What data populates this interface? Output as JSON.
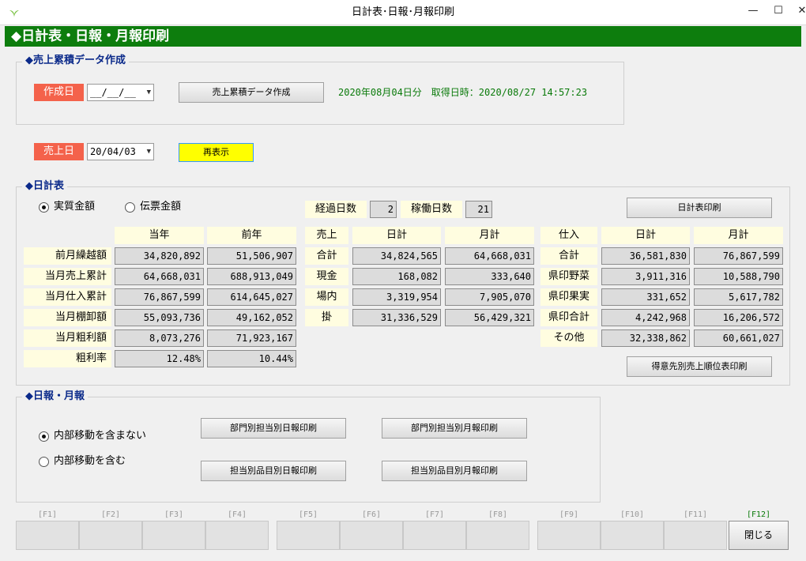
{
  "window": {
    "title": "日計表･日報･月報印刷",
    "min": "—",
    "max": "☐",
    "close": "✕"
  },
  "banner": "◆日計表・日報・月報印刷",
  "sales_data_group": {
    "title": "◆売上累積データ作成",
    "date_label": "作成日",
    "date_value": "__/__/__",
    "create_button": "売上累積データ作成",
    "status_text": "2020年08月04日分　取得日時：2020/08/27 14:57:23"
  },
  "sales_date": {
    "label": "売上日",
    "value": "20/04/03",
    "redisplay_button": "再表示"
  },
  "daily": {
    "title": "◆日計表",
    "radio_actual": "実質金額",
    "radio_slip": "伝票金額",
    "elapsed_label": "経過日数",
    "elapsed_value": "2",
    "working_label": "稼働日数",
    "working_value": "21",
    "print_button": "日計表印刷",
    "rank_button": "得意先別売上順位表印刷",
    "left_headers": [
      "当年",
      "前年"
    ],
    "left_rows": [
      {
        "label": "前月繰越額",
        "cur": "34,820,892",
        "prev": "51,506,907"
      },
      {
        "label": "当月売上累計",
        "cur": "64,668,031",
        "prev": "688,913,049"
      },
      {
        "label": "当月仕入累計",
        "cur": "76,867,599",
        "prev": "614,645,027"
      },
      {
        "label": "当月棚卸額",
        "cur": "55,093,736",
        "prev": "49,162,052"
      },
      {
        "label": "当月粗利額",
        "cur": "8,073,276",
        "prev": "71,923,167"
      },
      {
        "label": "粗利率",
        "cur": "12.48%",
        "prev": "10.44%"
      }
    ],
    "mid_headers": [
      "売上",
      "日計",
      "月計"
    ],
    "mid_rows": [
      {
        "label": "合計",
        "day": "34,824,565",
        "month": "64,668,031"
      },
      {
        "label": "現金",
        "day": "168,082",
        "month": "333,640"
      },
      {
        "label": "場内",
        "day": "3,319,954",
        "month": "7,905,070"
      },
      {
        "label": "掛",
        "day": "31,336,529",
        "month": "56,429,321"
      }
    ],
    "right_headers": [
      "仕入",
      "日計",
      "月計"
    ],
    "right_rows": [
      {
        "label": "合計",
        "day": "36,581,830",
        "month": "76,867,599"
      },
      {
        "label": "県印野菜",
        "day": "3,911,316",
        "month": "10,588,790"
      },
      {
        "label": "県印果実",
        "day": "331,652",
        "month": "5,617,782"
      },
      {
        "label": "県印合計",
        "day": "4,242,968",
        "month": "16,206,572"
      },
      {
        "label": "その他",
        "day": "32,338,862",
        "month": "60,661,027"
      }
    ]
  },
  "reports": {
    "title": "◆日報・月報",
    "radio_exclude": "内部移動を含まない",
    "radio_include": "内部移動を含む",
    "btn_dept_daily": "部門別担当別日報印刷",
    "btn_dept_monthly": "部門別担当別月報印刷",
    "btn_item_daily": "担当別品目別日報印刷",
    "btn_item_monthly": "担当別品目別月報印刷"
  },
  "fkeys": {
    "labels": [
      "[F1]",
      "[F2]",
      "[F3]",
      "[F4]",
      "[F5]",
      "[F6]",
      "[F7]",
      "[F8]",
      "[F9]",
      "[F10]",
      "[F11]",
      "[F12]"
    ],
    "f12_button": "閉じる"
  },
  "colors": {
    "banner": "#0d7d0d",
    "red_label": "#f4624b",
    "group_title": "#0b2a8a",
    "highlight": "#ffff00"
  }
}
